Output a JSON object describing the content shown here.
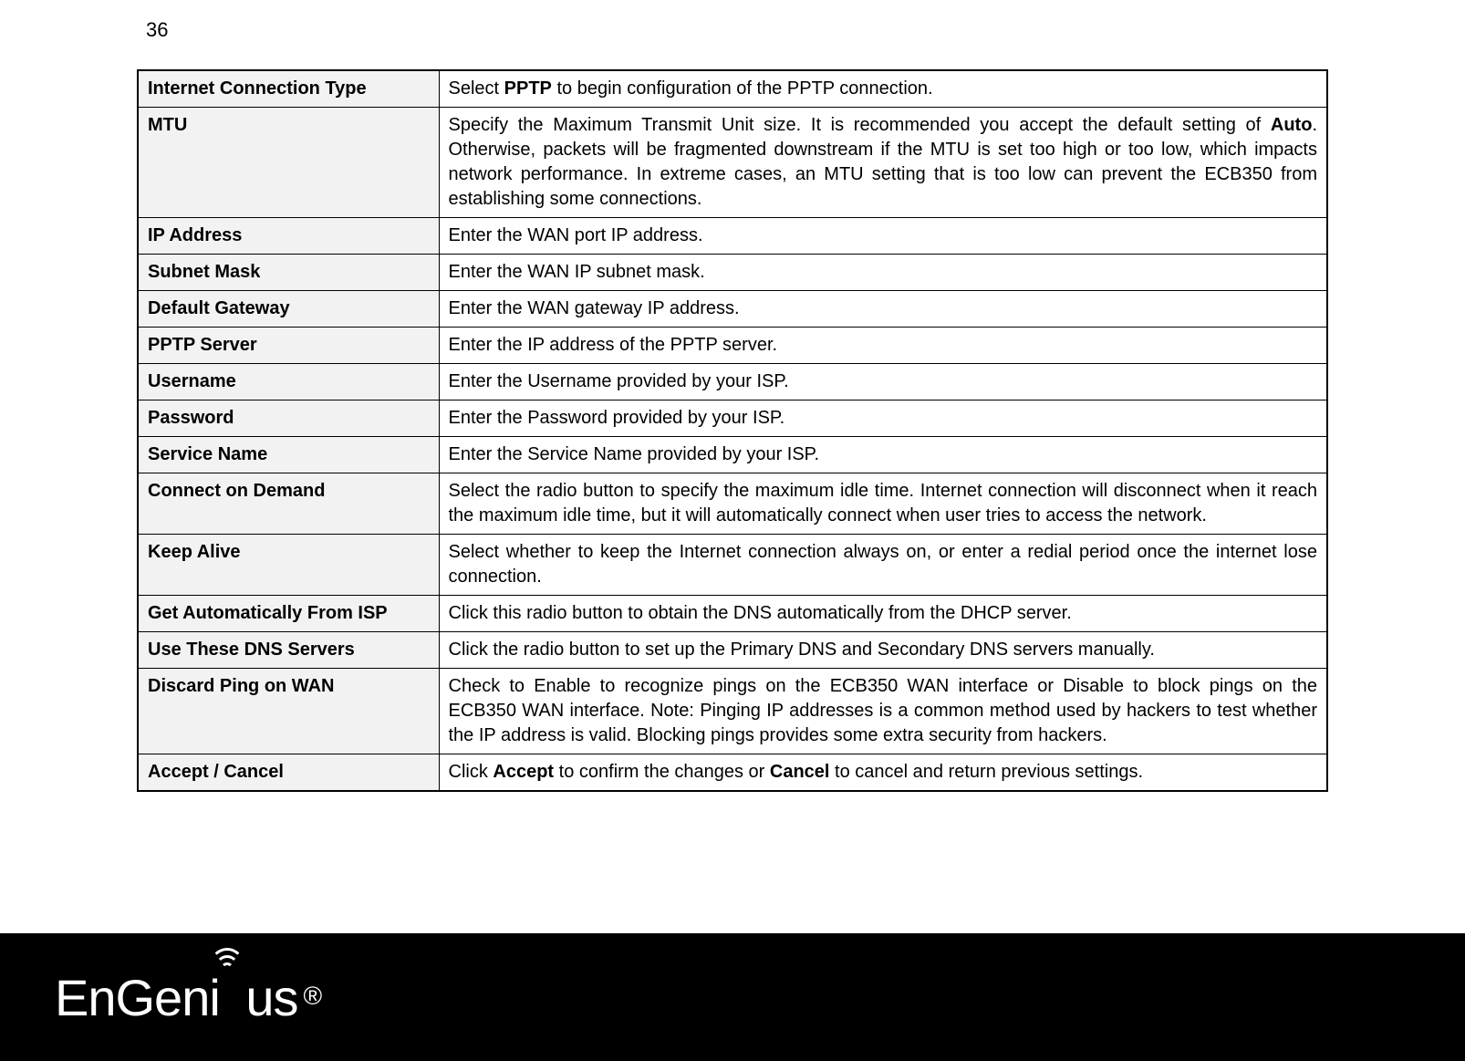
{
  "page_number": "36",
  "rows": [
    {
      "key": "Internet Connection Type",
      "desc_pre": "Select ",
      "desc_b1": "PPTP",
      "desc_post": " to begin configuration of the PPTP connection."
    },
    {
      "key": "MTU",
      "desc_pre": "Specify the Maximum Transmit Unit size. It is recommended you accept the default setting of ",
      "desc_b1": "Auto",
      "desc_post": ". Otherwise, packets will be fragmented downstream if the MTU is set too high or too low, which impacts network performance. In extreme cases, an MTU setting that is too low can prevent the ECB350 from establishing some connections."
    },
    {
      "key": "IP Address",
      "desc_pre": "Enter the WAN port IP address.",
      "desc_b1": "",
      "desc_post": ""
    },
    {
      "key": "Subnet Mask",
      "desc_pre": "Enter the WAN IP subnet mask.",
      "desc_b1": "",
      "desc_post": ""
    },
    {
      "key": "Default Gateway",
      "desc_pre": "Enter the WAN gateway IP address.",
      "desc_b1": "",
      "desc_post": ""
    },
    {
      "key": "PPTP Server",
      "desc_pre": "Enter the IP address of the PPTP server.",
      "desc_b1": "",
      "desc_post": ""
    },
    {
      "key": "Username",
      "desc_pre": "Enter the Username provided by your ISP.",
      "desc_b1": "",
      "desc_post": ""
    },
    {
      "key": "Password",
      "desc_pre": "Enter the Password provided by your ISP.",
      "desc_b1": "",
      "desc_post": ""
    },
    {
      "key": "Service Name",
      "desc_pre": "Enter the Service Name provided by your ISP.",
      "desc_b1": "",
      "desc_post": ""
    },
    {
      "key": "Connect on Demand",
      "desc_pre": "Select the radio button to specify the maximum idle time. Internet connection will disconnect when it reach the maximum idle time, but it will automatically connect when user tries to access the network.",
      "desc_b1": "",
      "desc_post": ""
    },
    {
      "key": "Keep Alive",
      "desc_pre": "Select whether to keep the Internet connection always on, or enter a redial period once the internet lose connection.",
      "desc_b1": "",
      "desc_post": ""
    },
    {
      "key": "Get Automatically From ISP",
      "desc_pre": "Click this radio button to obtain the DNS automatically from the DHCP server.",
      "desc_b1": "",
      "desc_post": ""
    },
    {
      "key": "Use These DNS Servers",
      "desc_pre": "Click the radio button to set up the Primary DNS and Secondary DNS servers manually.",
      "desc_b1": "",
      "desc_post": ""
    },
    {
      "key": "Discard Ping on WAN",
      "desc_pre": "Check to Enable to recognize pings on the ECB350 WAN interface or Disable to block pings on the ECB350 WAN interface. Note: Pinging IP addresses is a common method used by hackers to test whether the IP address is valid. Blocking pings provides some extra security from hackers.",
      "desc_b1": "",
      "desc_post": ""
    },
    {
      "key": "Accept / Cancel",
      "desc_pre": "Click ",
      "desc_b1": "Accept",
      "desc_mid": " to confirm the changes or ",
      "desc_b2": "Cancel",
      "desc_post": " to cancel and return previous settings."
    }
  ],
  "logo": {
    "text_left": "EnGen",
    "text_i": "i",
    "text_right": "us",
    "reg": "®"
  }
}
